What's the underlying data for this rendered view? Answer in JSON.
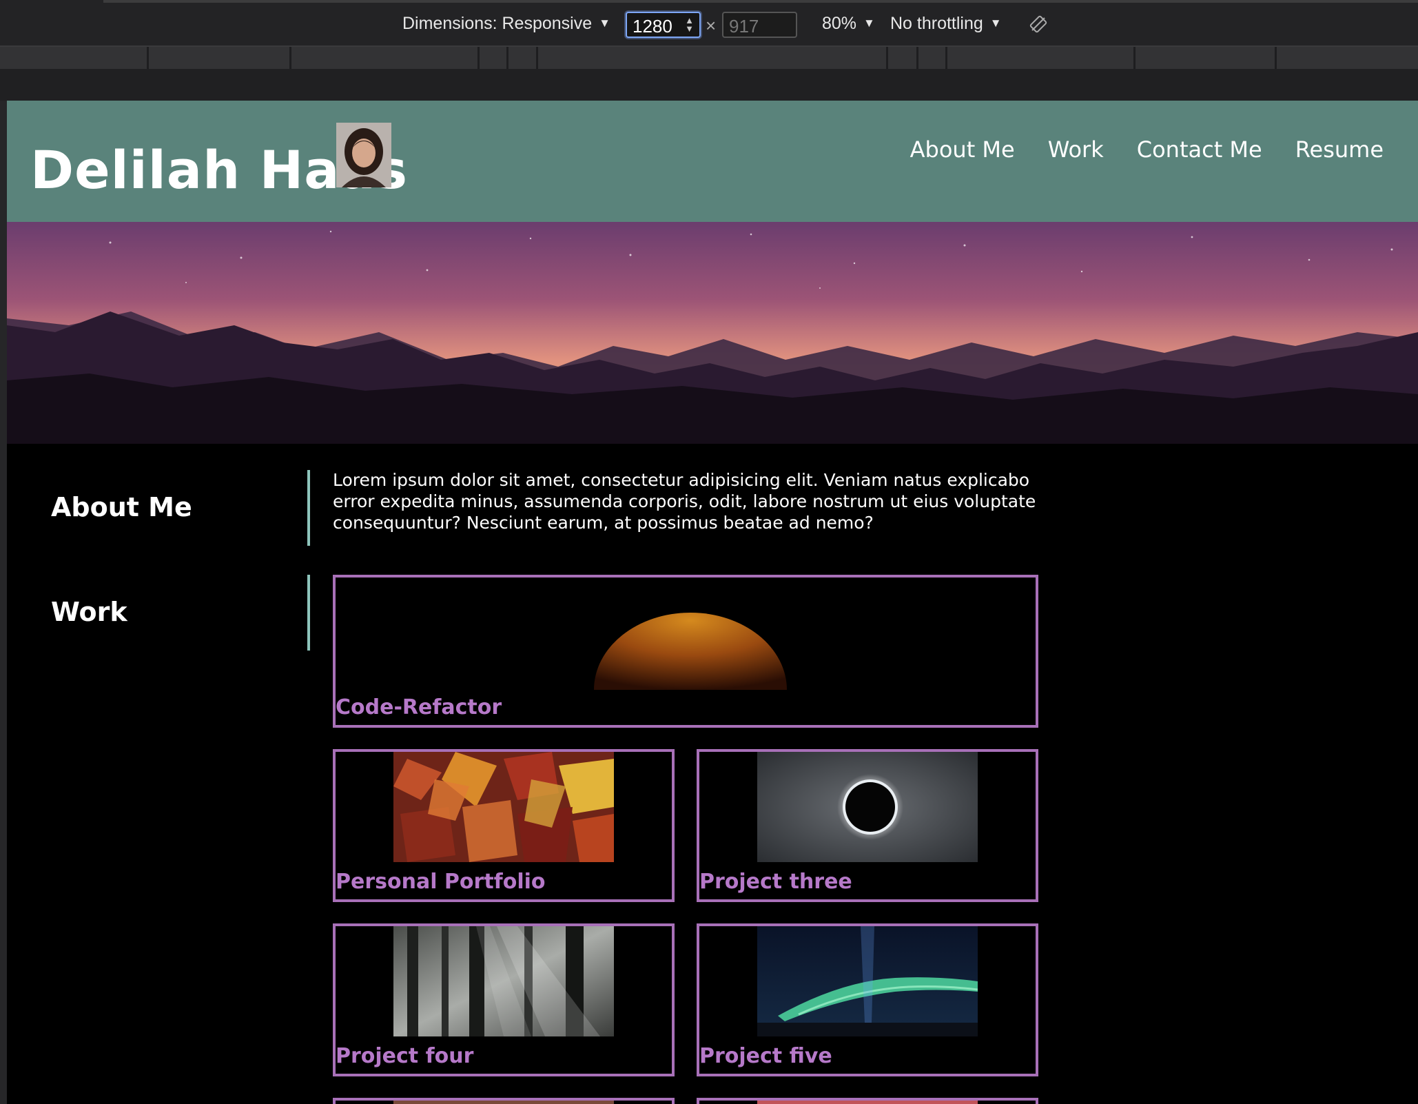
{
  "devtools": {
    "dimensions_label": "Dimensions: Responsive",
    "width_value": "1280",
    "height_value": "917",
    "zoom_label": "80%",
    "throttling_label": "No throttling"
  },
  "header": {
    "title": "Delilah Haas",
    "nav": [
      "About Me",
      "Work",
      "Contact Me",
      "Resume"
    ],
    "background": "#5a837b"
  },
  "about": {
    "heading": "About Me",
    "text": "Lorem ipsum dolor sit amet, consectetur adipisicing elit. Veniam natus explicabo error expedita minus, assumenda corporis, odit, labore nostrum ut eius voluptate consequuntur? Nesciunt earum, at possimus beatae ad nemo?"
  },
  "work": {
    "heading": "Work",
    "projects": [
      {
        "title": "Code-Refactor",
        "image": "planet-eclipse"
      },
      {
        "title": "Personal Portfolio",
        "image": "autumn-leaves"
      },
      {
        "title": "Project three",
        "image": "solar-eclipse"
      },
      {
        "title": "Project four",
        "image": "misty-forest"
      },
      {
        "title": "Project five",
        "image": "aurora"
      }
    ],
    "border_color": "#a870b8",
    "caption_color": "#b679c9",
    "accent_bar_color": "#8ec5bc"
  }
}
